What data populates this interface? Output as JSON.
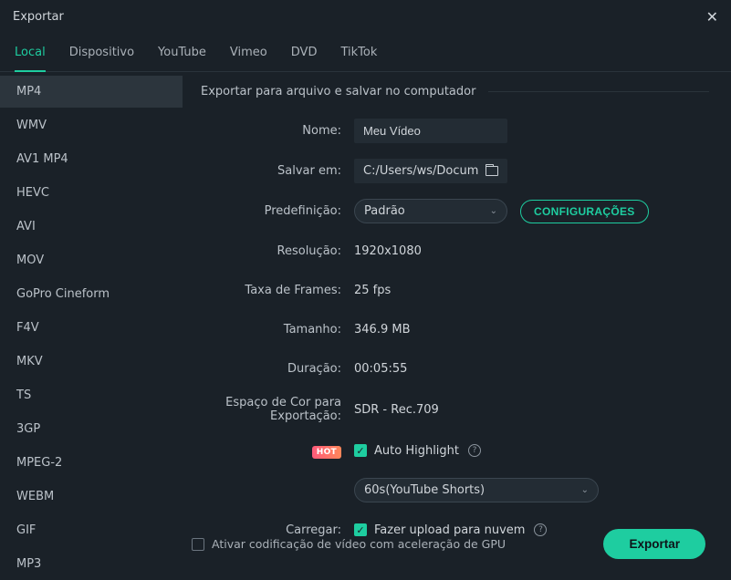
{
  "window": {
    "title": "Exportar"
  },
  "tabs": [
    "Local",
    "Dispositivo",
    "YouTube",
    "Vimeo",
    "DVD",
    "TikTok"
  ],
  "activeTab": 0,
  "formats": [
    "MP4",
    "WMV",
    "AV1 MP4",
    "HEVC",
    "AVI",
    "MOV",
    "GoPro Cineform",
    "F4V",
    "MKV",
    "TS",
    "3GP",
    "MPEG-2",
    "WEBM",
    "GIF",
    "MP3"
  ],
  "selectedFormat": 0,
  "section": {
    "title": "Exportar para arquivo e salvar no computador"
  },
  "labels": {
    "name": "Nome:",
    "saveTo": "Salvar em:",
    "preset": "Predefinição:",
    "resolution": "Resolução:",
    "framerate": "Taxa de Frames:",
    "size": "Tamanho:",
    "duration": "Duração:",
    "colorspace": "Espaço de Cor para Exportação:",
    "upload": "Carregar:"
  },
  "values": {
    "name": "Meu Vídeo",
    "saveTo": "C:/Users/ws/Docum",
    "preset": "Padrão",
    "resolution": "1920x1080",
    "framerate": "25 fps",
    "size": "346.9 MB",
    "duration": "00:05:55",
    "colorspace": "SDR - Rec.709",
    "autoHighlight": "Auto Highlight",
    "autoHighlightPreset": "60s(YouTube Shorts)",
    "uploadCloud": "Fazer upload para nuvem"
  },
  "buttons": {
    "config": "CONFIGURAÇÕES",
    "export": "Exportar"
  },
  "badges": {
    "hot": "HOT"
  },
  "footer": {
    "gpu": "Ativar codificação de vídeo com aceleração de GPU"
  }
}
